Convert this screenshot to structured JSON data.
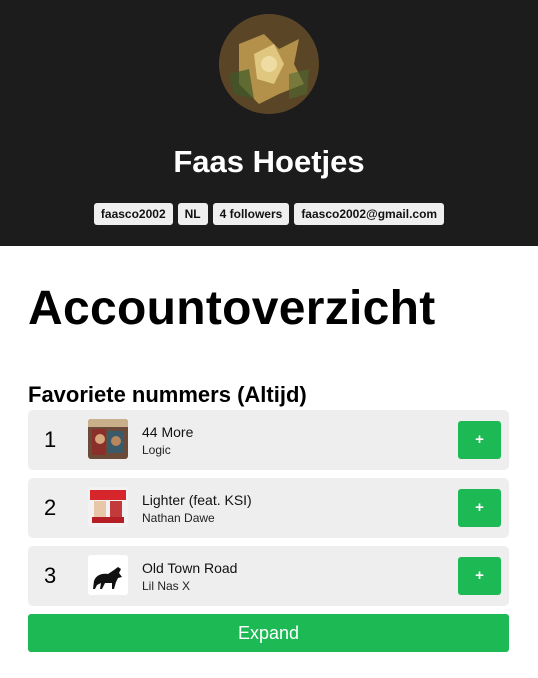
{
  "profile": {
    "name": "Faas Hoetjes",
    "badges": [
      "faasco2002",
      "NL",
      "4 followers",
      "faasco2002@gmail.com"
    ]
  },
  "page_title": "Accountoverzicht",
  "favorites": {
    "title": "Favoriete nummers (Altijd)",
    "tracks": [
      {
        "rank": "1",
        "name": "44 More",
        "artist": "Logic",
        "add_label": "+"
      },
      {
        "rank": "2",
        "name": "Lighter (feat. KSI)",
        "artist": "Nathan Dawe",
        "add_label": "+"
      },
      {
        "rank": "3",
        "name": "Old Town Road",
        "artist": "Lil Nas X",
        "add_label": "+"
      }
    ],
    "expand_label": "Expand"
  },
  "colors": {
    "header_bg": "#1c1c1c",
    "accent_green": "#1db954",
    "row_bg": "#eeeeee",
    "badge_bg": "#efefef"
  }
}
